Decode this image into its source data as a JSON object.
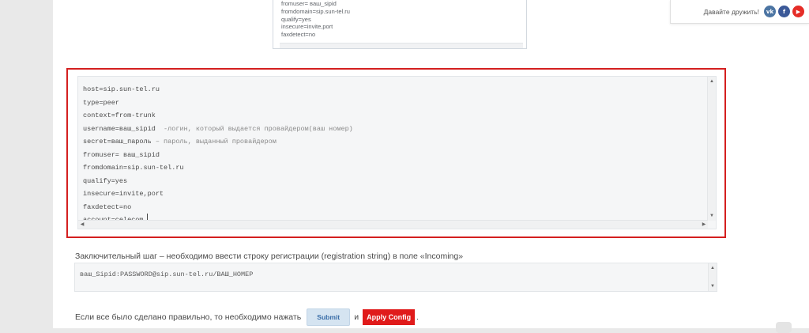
{
  "social": {
    "label": "Давайте дружить!",
    "icons": [
      {
        "name": "vk-icon",
        "glyph": "vk",
        "color": "#4c75a3"
      },
      {
        "name": "facebook-icon",
        "glyph": "f",
        "color": "#3b5998"
      },
      {
        "name": "youtube-icon",
        "glyph": "▶",
        "color": "#e52d27"
      }
    ]
  },
  "top_snippet": {
    "lines": [
      "fromuser= ваш_sipid",
      "fromdomain=sip.sun-tel.ru",
      "qualify=yes",
      "insecure=invite,port",
      "faxdetect=no"
    ]
  },
  "config": {
    "lines": [
      {
        "text": "host=sip.sun-tel.ru",
        "comment": ""
      },
      {
        "text": "type=peer",
        "comment": ""
      },
      {
        "text": "context=from-trunk",
        "comment": ""
      },
      {
        "text": "username=ваш_sipid",
        "comment": "  -логин, который выдается провайдером(ваш номер)"
      },
      {
        "text": "secret=ваш_пароль",
        "comment": " – пароль, выданный провайдером"
      },
      {
        "text": "fromuser= ваш_sipid",
        "comment": ""
      },
      {
        "text": "fromdomain=sip.sun-tel.ru",
        "comment": ""
      },
      {
        "text": "qualify=yes",
        "comment": ""
      },
      {
        "text": "insecure=invite,port",
        "comment": ""
      },
      {
        "text": "faxdetect=no",
        "comment": ""
      },
      {
        "text": "account=celecom",
        "comment": ""
      }
    ]
  },
  "instruction": {
    "text": "Заключительный шаг – необходимо ввести строку регистрации (registration string) в поле «Incoming»"
  },
  "registration": {
    "value": "ваш_Sipid:PASSWORD@sip.sun-tel.ru/ВАШ_НОМЕР"
  },
  "final": {
    "text": "Если все было сделано правильно, то необходимо нажать",
    "submit_label": "Submit",
    "and": "и",
    "apply_label": "Apply Config",
    "end": "."
  },
  "colors": {
    "highlight_border": "#d41f1f",
    "apply_bg": "#e01b1b",
    "submit_bg": "#d5e4f1"
  }
}
